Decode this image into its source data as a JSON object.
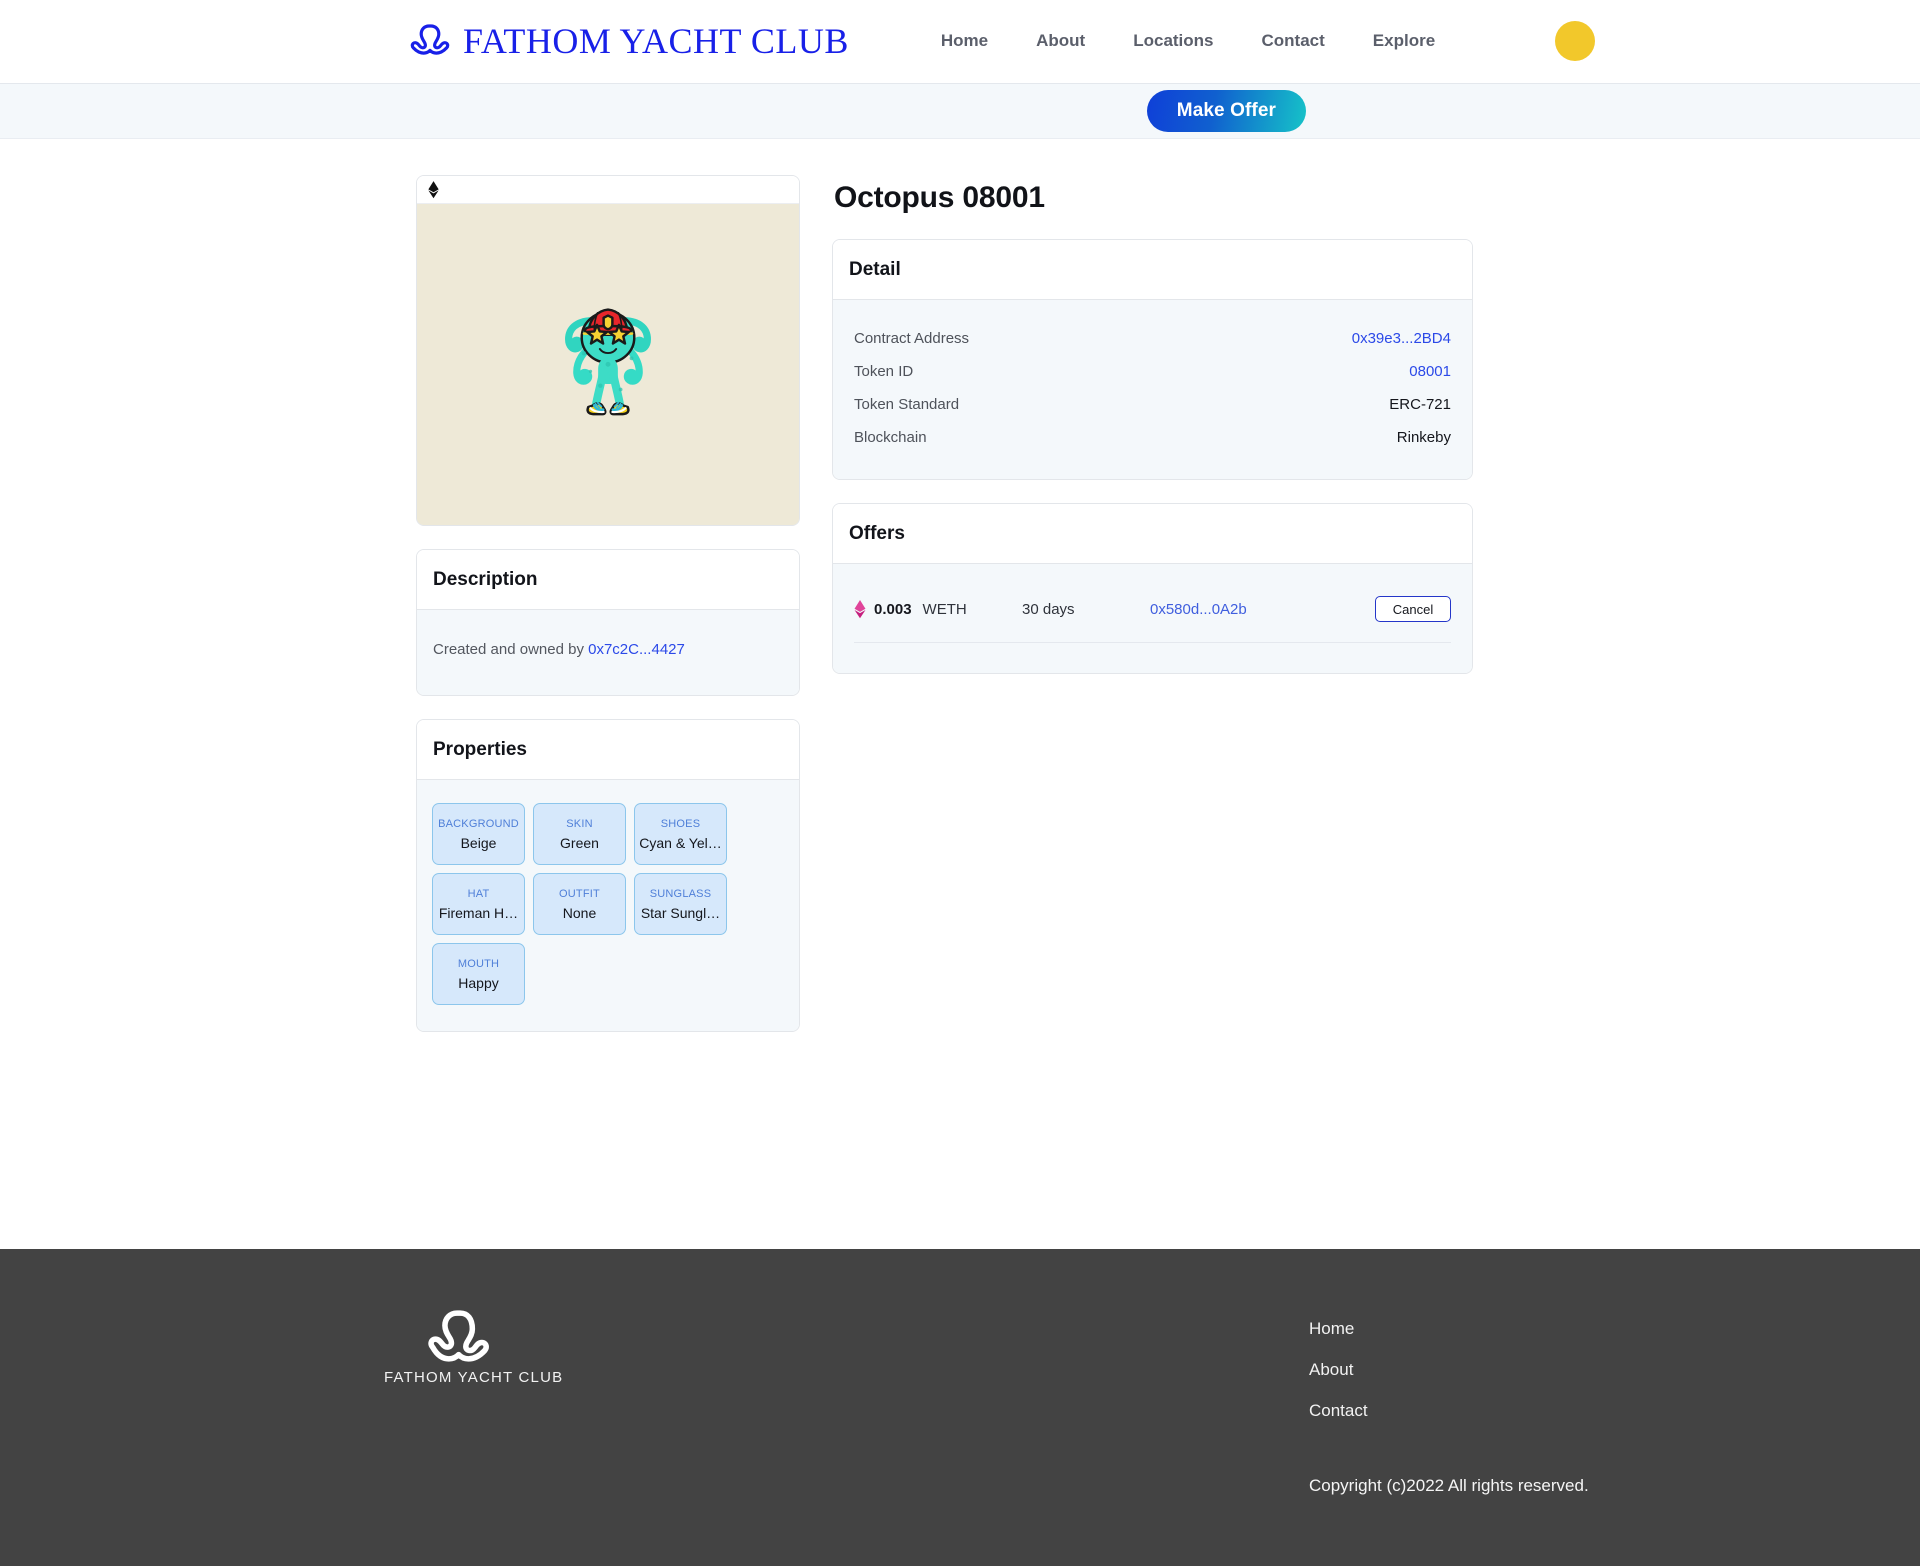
{
  "header": {
    "brand_name": "FATHOM YACHT CLUB",
    "logo_icon": "octopus-logo-icon",
    "nav": [
      {
        "label": "Home"
      },
      {
        "label": "About"
      },
      {
        "label": "Locations"
      },
      {
        "label": "Contact"
      },
      {
        "label": "Explore"
      }
    ],
    "wallet_avatar_color": "#f2c82b"
  },
  "action_bar": {
    "make_offer_label": "Make Offer",
    "gradient_from": "#0f3fd8",
    "gradient_to": "#16c3c8"
  },
  "nft": {
    "title": "Octopus 08001",
    "chain_icon": "ethereum-icon",
    "art_background": "#eee9d7",
    "art_alt": "Teal octopus wearing a red fireman helmet, yellow star sunglasses and cyan-yellow sneakers"
  },
  "description": {
    "heading": "Description",
    "prefix": "Created and owned by ",
    "owner_address": "0x7c2C...4427"
  },
  "properties": {
    "heading": "Properties",
    "items": [
      {
        "key": "BACKGROUND",
        "value": "Beige"
      },
      {
        "key": "SKIN",
        "value": "Green"
      },
      {
        "key": "SHOES",
        "value": "Cyan & Yel…"
      },
      {
        "key": "HAT",
        "value": "Fireman H…"
      },
      {
        "key": "OUTFIT",
        "value": "None"
      },
      {
        "key": "SUNGLASS",
        "value": "Star Sungl…"
      },
      {
        "key": "MOUTH",
        "value": "Happy"
      }
    ]
  },
  "detail": {
    "heading": "Detail",
    "rows": [
      {
        "label": "Contract Address",
        "value": "0x39e3...2BD4",
        "is_link": true
      },
      {
        "label": "Token ID",
        "value": "08001",
        "is_link": true
      },
      {
        "label": "Token Standard",
        "value": "ERC-721",
        "is_link": false
      },
      {
        "label": "Blockchain",
        "value": "Rinkeby",
        "is_link": false
      }
    ]
  },
  "offers": {
    "heading": "Offers",
    "rows": [
      {
        "currency_icon": "ethereum-icon",
        "amount": "0.003",
        "unit": "WETH",
        "expiry": "30 days",
        "from": "0x580d...0A2b",
        "action_label": "Cancel"
      }
    ]
  },
  "footer": {
    "brand_name": "FATHOM YACHT CLUB",
    "logo_icon": "octopus-logo-icon",
    "links": [
      {
        "label": "Home"
      },
      {
        "label": "About"
      },
      {
        "label": "Contact"
      }
    ],
    "copyright": "Copyright (c)2022 All rights reserved.",
    "background": "#434343"
  }
}
